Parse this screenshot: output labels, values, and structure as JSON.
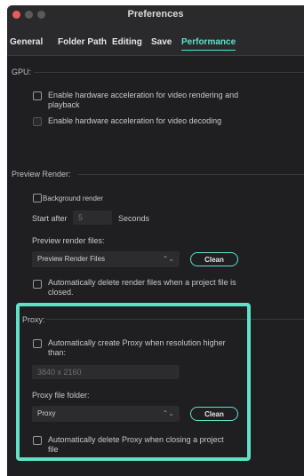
{
  "window": {
    "title": "Preferences"
  },
  "tabs": [
    "General",
    "Folder Path",
    "Editing",
    "Save",
    "Performance"
  ],
  "gpu": {
    "label": "GPU:",
    "hw_render_label": "Enable hardware acceleration for video rendering and playback",
    "hw_decode_label": "Enable hardware acceleration for video decoding"
  },
  "preview_render": {
    "label": "Preview Render:",
    "background_render_label": "Background render",
    "start_after_label": "Start after",
    "start_after_value": "5",
    "seconds_label": "Seconds",
    "files_label": "Preview render files:",
    "files_select": "Preview Render Files",
    "clean_label": "Clean",
    "auto_delete_label": "Automatically delete render files when a project file is closed."
  },
  "proxy": {
    "label": "Proxy:",
    "auto_create_label": "Automatically create Proxy when resolution higher than:",
    "resolution_placeholder": "3840 x 2160",
    "folder_label": "Proxy file folder:",
    "folder_select": "Proxy",
    "clean_label": "Clean",
    "auto_delete_label": "Automatically delete Proxy when closing a project file"
  },
  "colors": {
    "accent": "#5fe0c7",
    "close": "#ec5b56"
  },
  "icons": [
    "chevron-updown-icon"
  ]
}
